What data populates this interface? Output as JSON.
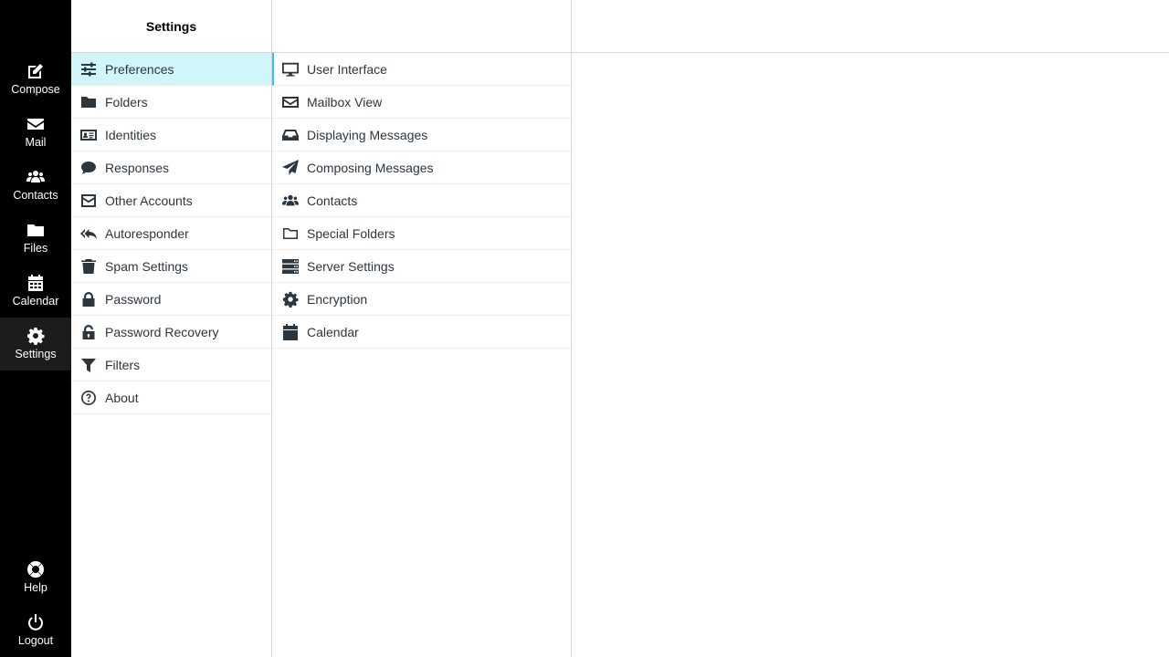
{
  "nav": {
    "compose": "Compose",
    "mail": "Mail",
    "contacts": "Contacts",
    "files": "Files",
    "calendar": "Calendar",
    "settings": "Settings",
    "help": "Help",
    "logout": "Logout"
  },
  "settings": {
    "title": "Settings",
    "items": [
      {
        "label": "Preferences",
        "icon": "sliders-icon"
      },
      {
        "label": "Folders",
        "icon": "folder-icon"
      },
      {
        "label": "Identities",
        "icon": "id-card-icon"
      },
      {
        "label": "Responses",
        "icon": "comment-icon"
      },
      {
        "label": "Other Accounts",
        "icon": "envelope-square-icon"
      },
      {
        "label": "Autoresponder",
        "icon": "reply-all-icon"
      },
      {
        "label": "Spam Settings",
        "icon": "trash-icon"
      },
      {
        "label": "Password",
        "icon": "lock-icon"
      },
      {
        "label": "Password Recovery",
        "icon": "unlock-icon"
      },
      {
        "label": "Filters",
        "icon": "filter-icon"
      },
      {
        "label": "About",
        "icon": "question-circle-icon"
      }
    ]
  },
  "sections": {
    "items": [
      {
        "label": "User Interface",
        "icon": "desktop-icon"
      },
      {
        "label": "Mailbox View",
        "icon": "envelope-icon"
      },
      {
        "label": "Displaying Messages",
        "icon": "inbox-icon"
      },
      {
        "label": "Composing Messages",
        "icon": "paper-plane-icon"
      },
      {
        "label": "Contacts",
        "icon": "users-icon"
      },
      {
        "label": "Special Folders",
        "icon": "folder-outline-icon"
      },
      {
        "label": "Server Settings",
        "icon": "server-icon"
      },
      {
        "label": "Encryption",
        "icon": "gear-icon"
      },
      {
        "label": "Calendar",
        "icon": "calendar-icon"
      }
    ]
  },
  "colors": {
    "nav_bg": "#000000",
    "active_item_bg": "#d0f6f9",
    "accent": "#37beff",
    "text": "#2c363f"
  }
}
